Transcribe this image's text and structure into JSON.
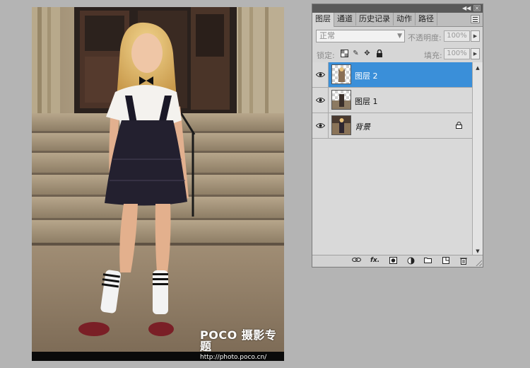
{
  "photo": {
    "watermark_brand": "POCO 摄影专题",
    "watermark_url": "http://photo.poco.cn/"
  },
  "panel": {
    "tabs": [
      {
        "label": "图层",
        "active": true
      },
      {
        "label": "通道",
        "active": false
      },
      {
        "label": "历史记录",
        "active": false
      },
      {
        "label": "动作",
        "active": false
      },
      {
        "label": "路径",
        "active": false
      }
    ],
    "blend_mode": "正常",
    "opacity_label": "不透明度:",
    "opacity_value": "100%",
    "lock_label": "锁定:",
    "fill_label": "填充:",
    "fill_value": "100%",
    "layers": [
      {
        "name": "图层 2",
        "selected": true,
        "visible": true,
        "thumbnail": "transparent-with-photo"
      },
      {
        "name": "图层 1",
        "selected": false,
        "visible": true,
        "thumbnail": "transparent-with-photo"
      },
      {
        "name": "背景",
        "selected": false,
        "visible": true,
        "thumbnail": "photo",
        "locked": true
      }
    ],
    "footer_icons": [
      "link-layers-icon",
      "fx-icon",
      "layer-mask-icon",
      "adjustment-layer-icon",
      "new-group-icon",
      "new-layer-icon",
      "trash-icon"
    ]
  },
  "colors": {
    "selection": "#3a8fd9",
    "panel_bg": "#d6d6d6",
    "workspace_bg": "#b4b4b4"
  }
}
